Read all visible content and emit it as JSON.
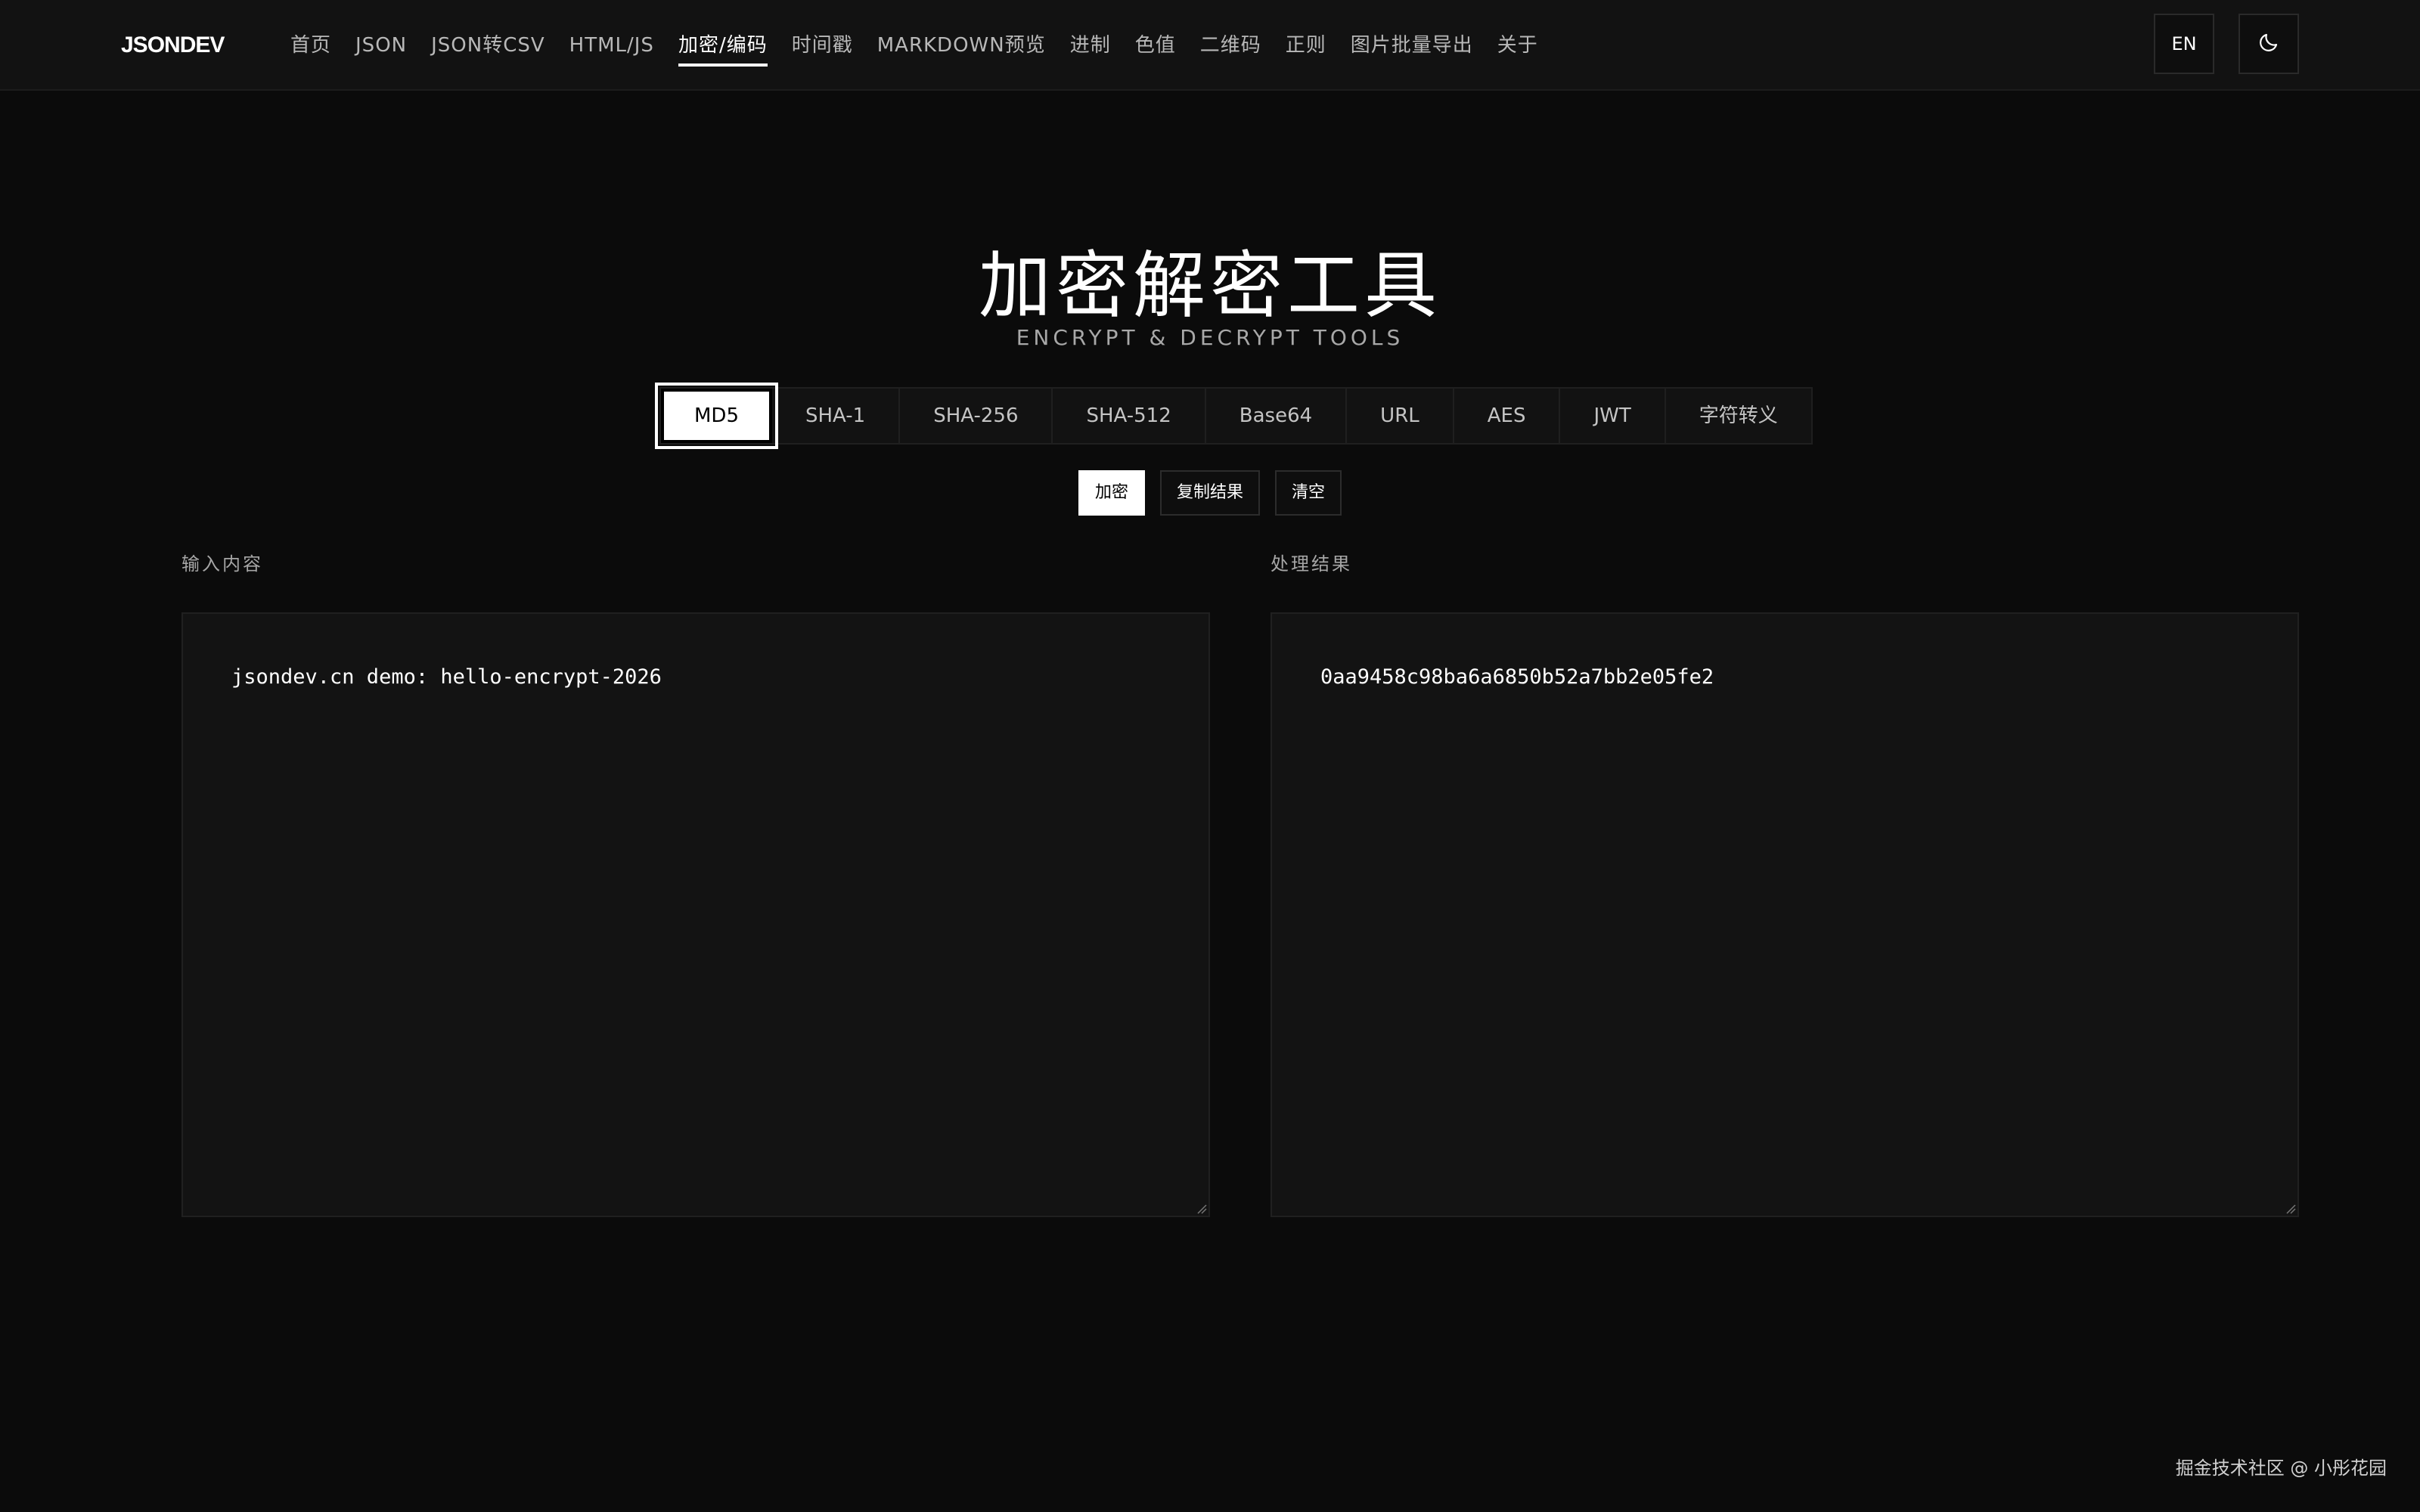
{
  "header": {
    "logo": "JSONDEV",
    "nav": [
      {
        "label": "首页"
      },
      {
        "label": "JSON"
      },
      {
        "label": "JSON转CSV"
      },
      {
        "label": "HTML/JS"
      },
      {
        "label": "加密/编码",
        "active": true
      },
      {
        "label": "时间戳"
      },
      {
        "label": "MARKDOWN预览"
      },
      {
        "label": "进制"
      },
      {
        "label": "色值"
      },
      {
        "label": "二维码"
      },
      {
        "label": "正则"
      },
      {
        "label": "图片批量导出"
      },
      {
        "label": "关于"
      }
    ],
    "lang_label": "EN",
    "theme_icon": "moon-icon"
  },
  "main": {
    "title": "加密解密工具",
    "subtitle": "ENCRYPT & DECRYPT TOOLS",
    "algorithms": [
      {
        "label": "MD5",
        "active": true
      },
      {
        "label": "SHA-1"
      },
      {
        "label": "SHA-256"
      },
      {
        "label": "SHA-512"
      },
      {
        "label": "Base64"
      },
      {
        "label": "URL"
      },
      {
        "label": "AES"
      },
      {
        "label": "JWT"
      },
      {
        "label": "字符转义"
      }
    ],
    "actions": {
      "encrypt": "加密",
      "copy": "复制结果",
      "clear": "清空"
    },
    "input": {
      "label": "输入内容",
      "value": "jsondev.cn demo: hello-encrypt-2026"
    },
    "output": {
      "label": "处理结果",
      "value": "0aa9458c98ba6a6850b52a7bb2e05fe2"
    }
  },
  "footer": {
    "credit": "掘金技术社区 @ 小彤花园"
  },
  "colors": {
    "background": "#0b0b0b",
    "panel": "#131313",
    "accent": "#ffffff"
  }
}
